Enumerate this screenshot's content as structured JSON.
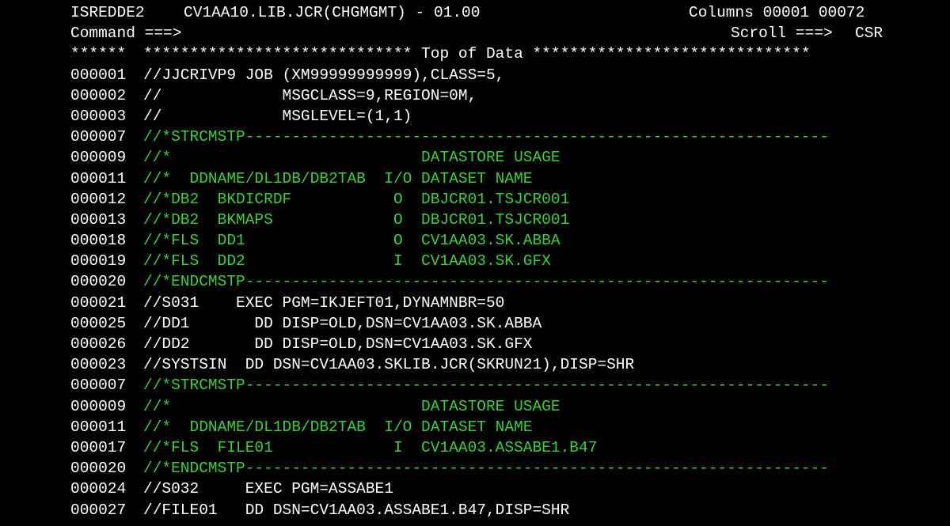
{
  "header": {
    "panel_id": "ISREDDE2",
    "dataset": "CV1AA10.LIB.JCR(CHGMGMT) - 01.00",
    "columns": "Columns 00001 00072",
    "command_label": "Command ===>",
    "command_value": "",
    "scroll_label": "Scroll ===>",
    "scroll_value": "CSR"
  },
  "top_marker": {
    "stars": "******",
    "banner": "***************************** Top of Data ******************************"
  },
  "colors": {
    "text": "#ffffff",
    "comment": "#3ccf3c",
    "background": "#000000"
  },
  "lines": [
    {
      "num": "000001",
      "text": "//JJCRIVP9 JOB (XM99999999999),CLASS=5,",
      "type": "code"
    },
    {
      "num": "000002",
      "text": "//             MSGCLASS=9,REGION=0M,",
      "type": "code"
    },
    {
      "num": "000003",
      "text": "//             MSGLEVEL=(1,1)",
      "type": "code"
    },
    {
      "num": "000007",
      "text": "//*STRCMSTP---------------------------------------------------------------",
      "type": "comment"
    },
    {
      "num": "000009",
      "text": "//*                           DATASTORE USAGE",
      "type": "comment"
    },
    {
      "num": "000011",
      "text": "//*  DDNAME/DL1DB/DB2TAB  I/O DATASET NAME",
      "type": "comment"
    },
    {
      "num": "000012",
      "text": "//*DB2  BKDICRDF           O  DBJCR01.TSJCR001",
      "type": "comment"
    },
    {
      "num": "000013",
      "text": "//*DB2  BKMAPS             O  DBJCR01.TSJCR001",
      "type": "comment"
    },
    {
      "num": "000018",
      "text": "//*FLS  DD1                O  CV1AA03.SK.ABBA",
      "type": "comment"
    },
    {
      "num": "000019",
      "text": "//*FLS  DD2                I  CV1AA03.SK.GFX",
      "type": "comment"
    },
    {
      "num": "000020",
      "text": "//*ENDCMSTP---------------------------------------------------------------",
      "type": "comment"
    },
    {
      "num": "000021",
      "text": "//S031    EXEC PGM=IKJEFT01,DYNAMNBR=50",
      "type": "code"
    },
    {
      "num": "000025",
      "text": "//DD1       DD DISP=OLD,DSN=CV1AA03.SK.ABBA",
      "type": "code"
    },
    {
      "num": "000026",
      "text": "//DD2       DD DISP=OLD,DSN=CV1AA03.SK.GFX",
      "type": "code"
    },
    {
      "num": "000023",
      "text": "//SYSTSIN  DD DSN=CV1AA03.SKLIB.JCR(SKRUN21),DISP=SHR",
      "type": "code"
    },
    {
      "num": "000007",
      "text": "//*STRCMSTP---------------------------------------------------------------",
      "type": "comment"
    },
    {
      "num": "000009",
      "text": "//*                           DATASTORE USAGE",
      "type": "comment"
    },
    {
      "num": "000011",
      "text": "//*  DDNAME/DL1DB/DB2TAB  I/O DATASET NAME",
      "type": "comment"
    },
    {
      "num": "000017",
      "text": "//*FLS  FILE01             I  CV1AA03.ASSABE1.B47",
      "type": "comment"
    },
    {
      "num": "000020",
      "text": "//*ENDCMSTP---------------------------------------------------------------",
      "type": "comment"
    },
    {
      "num": "000024",
      "text": "//S032     EXEC PGM=ASSABE1",
      "type": "code"
    },
    {
      "num": "000027",
      "text": "//FILE01   DD DSN=CV1AA03.ASSABE1.B47,DISP=SHR",
      "type": "code"
    }
  ]
}
